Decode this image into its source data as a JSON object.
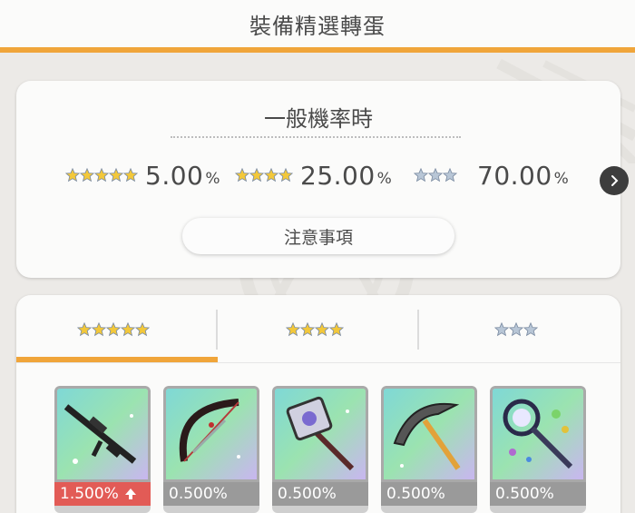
{
  "header": {
    "title": "裝備精選轉蛋"
  },
  "rates": {
    "title": "一般機率時",
    "items": [
      {
        "stars": 5,
        "star_color": "#f3c83a",
        "value": "5.00",
        "pct": "%"
      },
      {
        "stars": 4,
        "star_color": "#f3c83a",
        "value": "25.00",
        "pct": "%"
      },
      {
        "stars": 3,
        "star_color": "#b8c6d6",
        "value": "70.00",
        "pct": "%"
      }
    ],
    "notice_label": "注意事項",
    "next_icon": "chevron-right-icon"
  },
  "tabs": [
    {
      "stars": 5,
      "star_color": "#f3c83a",
      "active": true
    },
    {
      "stars": 4,
      "star_color": "#f3c83a",
      "active": false
    },
    {
      "stars": 3,
      "star_color": "#b8c6d6",
      "active": false
    }
  ],
  "items": [
    {
      "name": "sniper-rifle",
      "rate": "1.500%",
      "boosted": true
    },
    {
      "name": "bow",
      "rate": "0.500%",
      "boosted": false
    },
    {
      "name": "axe",
      "rate": "0.500%",
      "boosted": false
    },
    {
      "name": "scythe",
      "rate": "0.500%",
      "boosted": false
    },
    {
      "name": "magic-wand",
      "rate": "0.500%",
      "boosted": false
    }
  ],
  "colors": {
    "accent": "#f0a53a",
    "boost": "#e25b56",
    "rate_bg": "#9a9a9a"
  }
}
